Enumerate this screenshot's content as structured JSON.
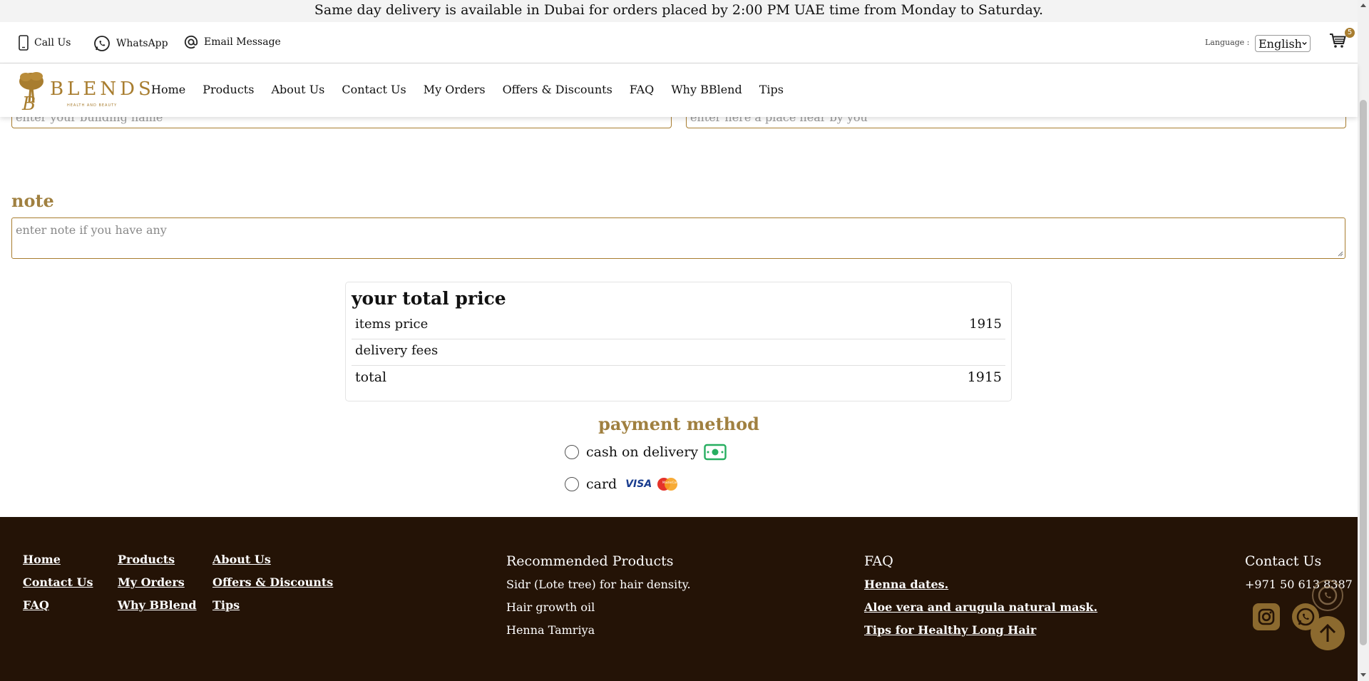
{
  "announcement": "Same day delivery is available in Dubai for orders placed by 2:00 PM UAE time from Monday to Saturday.",
  "contact_bar": {
    "call": "Call Us",
    "whatsapp": "WhatsApp",
    "email": "Email Message",
    "language_label": "Language :",
    "language_value": "English",
    "cart_count": "5"
  },
  "nav": {
    "logo_text": "BLENDS",
    "logo_sub": "HEALTH AND BEAUTY",
    "links": [
      "Home",
      "Products",
      "About Us",
      "Contact Us",
      "My Orders",
      "Offers & Discounts",
      "FAQ",
      "Why BBlend",
      "Tips"
    ]
  },
  "form": {
    "building_placeholder": "enter your building name",
    "landmark_placeholder": "enter here a place near by you",
    "note_title": "note",
    "note_placeholder": "enter note if you have any"
  },
  "totals": {
    "title": "your total price",
    "items_label": "items price",
    "items_value": "1915",
    "delivery_label": "delivery fees",
    "delivery_value": "",
    "total_label": "total",
    "total_value": "1915"
  },
  "payment": {
    "title": "payment method",
    "cash_label": "cash on delivery",
    "card_label": "card",
    "card_brand": "VISA",
    "card_brand2": "MasterCard"
  },
  "footer": {
    "links_col1": [
      "Home",
      "Contact Us",
      "FAQ"
    ],
    "links_col2": [
      "Products",
      "My Orders",
      "Why BBlend"
    ],
    "links_col3": [
      "About Us",
      "Offers & Discounts",
      "Tips"
    ],
    "recommended_title": "Recommended Products",
    "recommended": [
      "Sidr (Lote tree) for hair density.",
      "Hair growth oil",
      "Henna Tamriya"
    ],
    "faq_title": "FAQ",
    "faq_links": [
      "Henna dates.",
      "Aloe vera and arugula natural mask.",
      "Tips for Healthy Long Hair"
    ],
    "contact_title": "Contact Us",
    "phone": "+971 50 613 8387"
  },
  "colors": {
    "brand_gold": "#a87d2f",
    "footer_bg": "#241306",
    "cash_green": "#27ae60"
  }
}
